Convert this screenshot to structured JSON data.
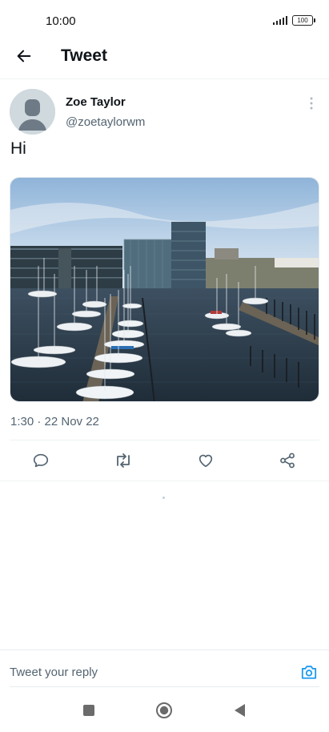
{
  "status_bar": {
    "time": "10:00",
    "battery": "100"
  },
  "header": {
    "title": "Tweet"
  },
  "tweet": {
    "author_name": "Zoe Taylor",
    "author_handle": "@zoetaylorwm",
    "text": "Hi",
    "timestamp": "1:30 · 22 Nov 22",
    "media_description_icon": "photo"
  },
  "reply": {
    "placeholder": "Tweet your reply"
  },
  "colors": {
    "accent": "#1d9bf0",
    "text": "#0f1419",
    "secondary": "#536471"
  },
  "icons": {
    "back": "arrow-left-icon",
    "more": "more-vertical-icon",
    "reply": "comment-icon",
    "retweet": "retweet-icon",
    "like": "heart-icon",
    "share": "share-icon",
    "camera": "camera-icon",
    "nav_recents": "square-icon",
    "nav_home": "circle-icon",
    "nav_back": "triangle-back-icon"
  }
}
